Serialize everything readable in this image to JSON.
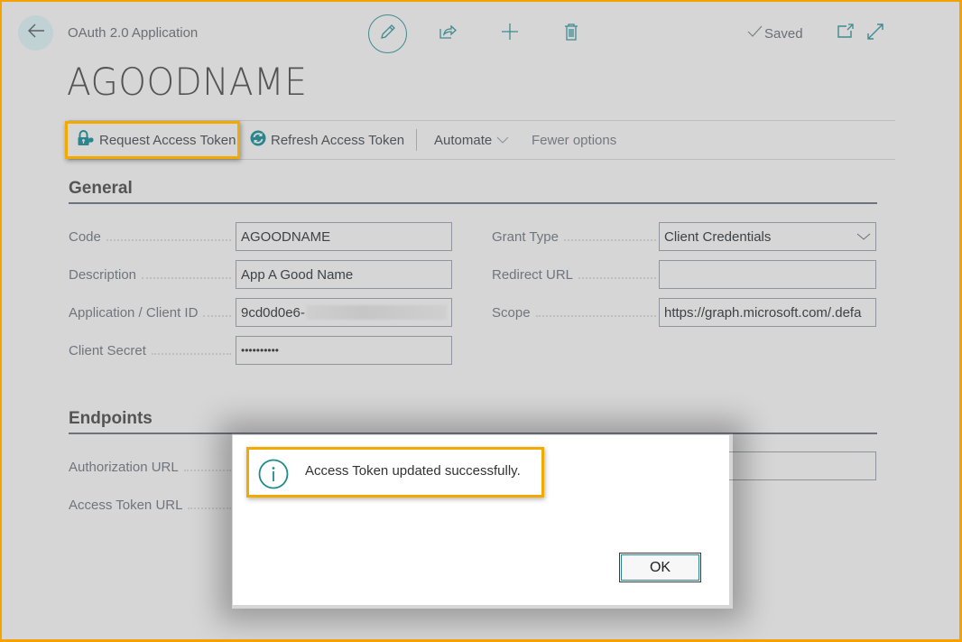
{
  "header": {
    "caption": "OAuth 2.0 Application",
    "title": "AGOODNAME",
    "status": "Saved",
    "icons": [
      "back-arrow-icon",
      "edit-icon",
      "share-icon",
      "add-icon",
      "delete-icon",
      "checkmark-icon",
      "open-new-window-icon",
      "expand-icon"
    ]
  },
  "actions": {
    "request_token": "Request Access Token",
    "refresh_token": "Refresh Access Token",
    "automate": "Automate",
    "fewer_options": "Fewer options"
  },
  "general": {
    "heading": "General",
    "left_fields": [
      {
        "label": "Code",
        "value": "AGOODNAME"
      },
      {
        "label": "Description",
        "value": "App A Good Name"
      },
      {
        "label": "Application / Client ID",
        "value": "9cd0d0e6-"
      },
      {
        "label": "Client Secret",
        "value": "••••••••••"
      }
    ],
    "right_fields": [
      {
        "label": "Grant Type",
        "value": "Client Credentials",
        "type": "select"
      },
      {
        "label": "Redirect URL",
        "value": ""
      },
      {
        "label": "Scope",
        "value": "https://graph.microsoft.com/.defa"
      }
    ]
  },
  "endpoints": {
    "heading": "Endpoints",
    "fields": [
      {
        "label": "Authorization URL",
        "value": ""
      },
      {
        "label": "Access Token URL",
        "value": ""
      }
    ]
  },
  "dialog": {
    "message": "Access Token updated successfully.",
    "ok_label": "OK",
    "icon": "info-icon"
  },
  "colors": {
    "accent": "#2a868c",
    "highlight": "#f2a900",
    "background": "#d6d6d6"
  }
}
